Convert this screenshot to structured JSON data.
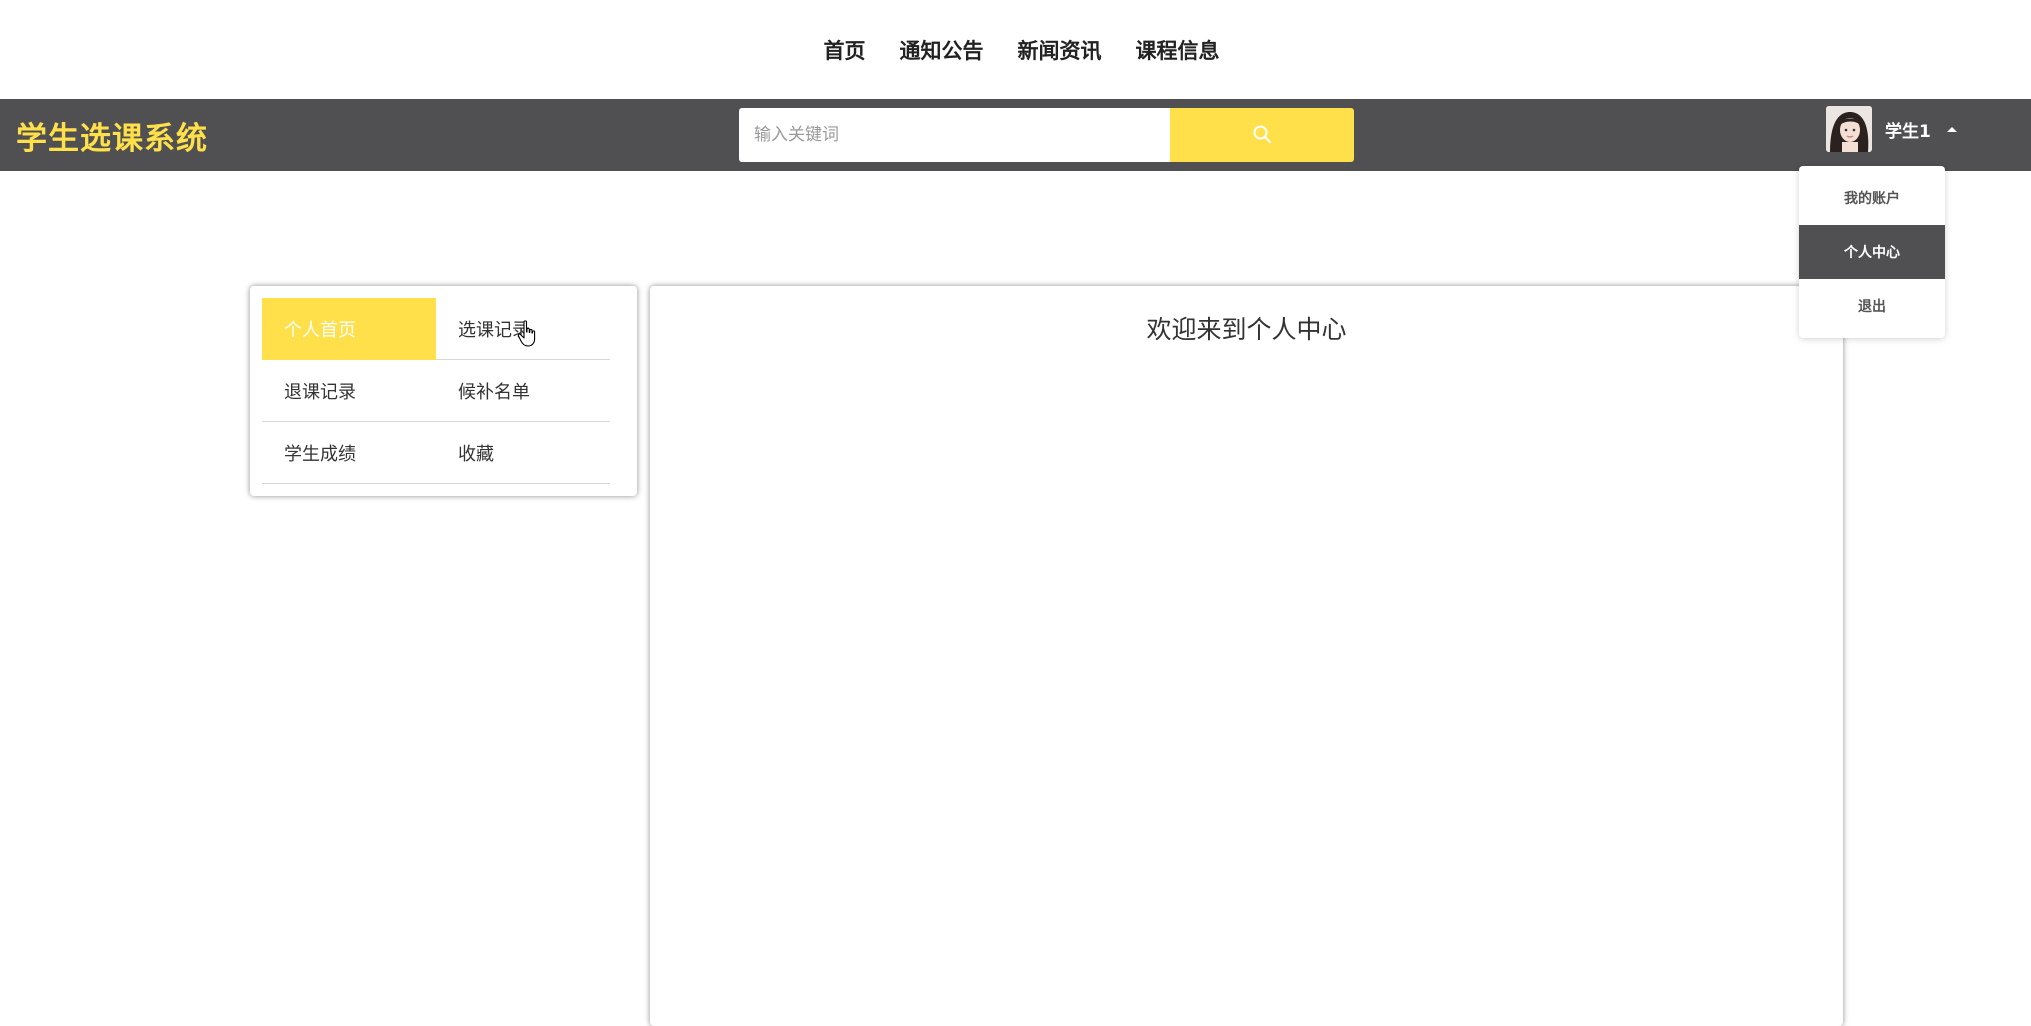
{
  "top_nav": [
    "首页",
    "通知公告",
    "新闻资讯",
    "课程信息"
  ],
  "header": {
    "brand": "学生选课系统",
    "search_placeholder": "输入关键词",
    "search_icon": "search-icon",
    "username": "学生1"
  },
  "user_menu": [
    "我的账户",
    "个人中心",
    "退出"
  ],
  "user_menu_active": "个人中心",
  "side_menu": [
    "个人首页",
    "选课记录",
    "退课记录",
    "候补名单",
    "学生成绩",
    "收藏"
  ],
  "side_menu_active": "个人首页",
  "content": {
    "title": "欢迎来到个人中心"
  },
  "colors": {
    "accent": "#ffe04a",
    "header_bg": "#505052"
  }
}
